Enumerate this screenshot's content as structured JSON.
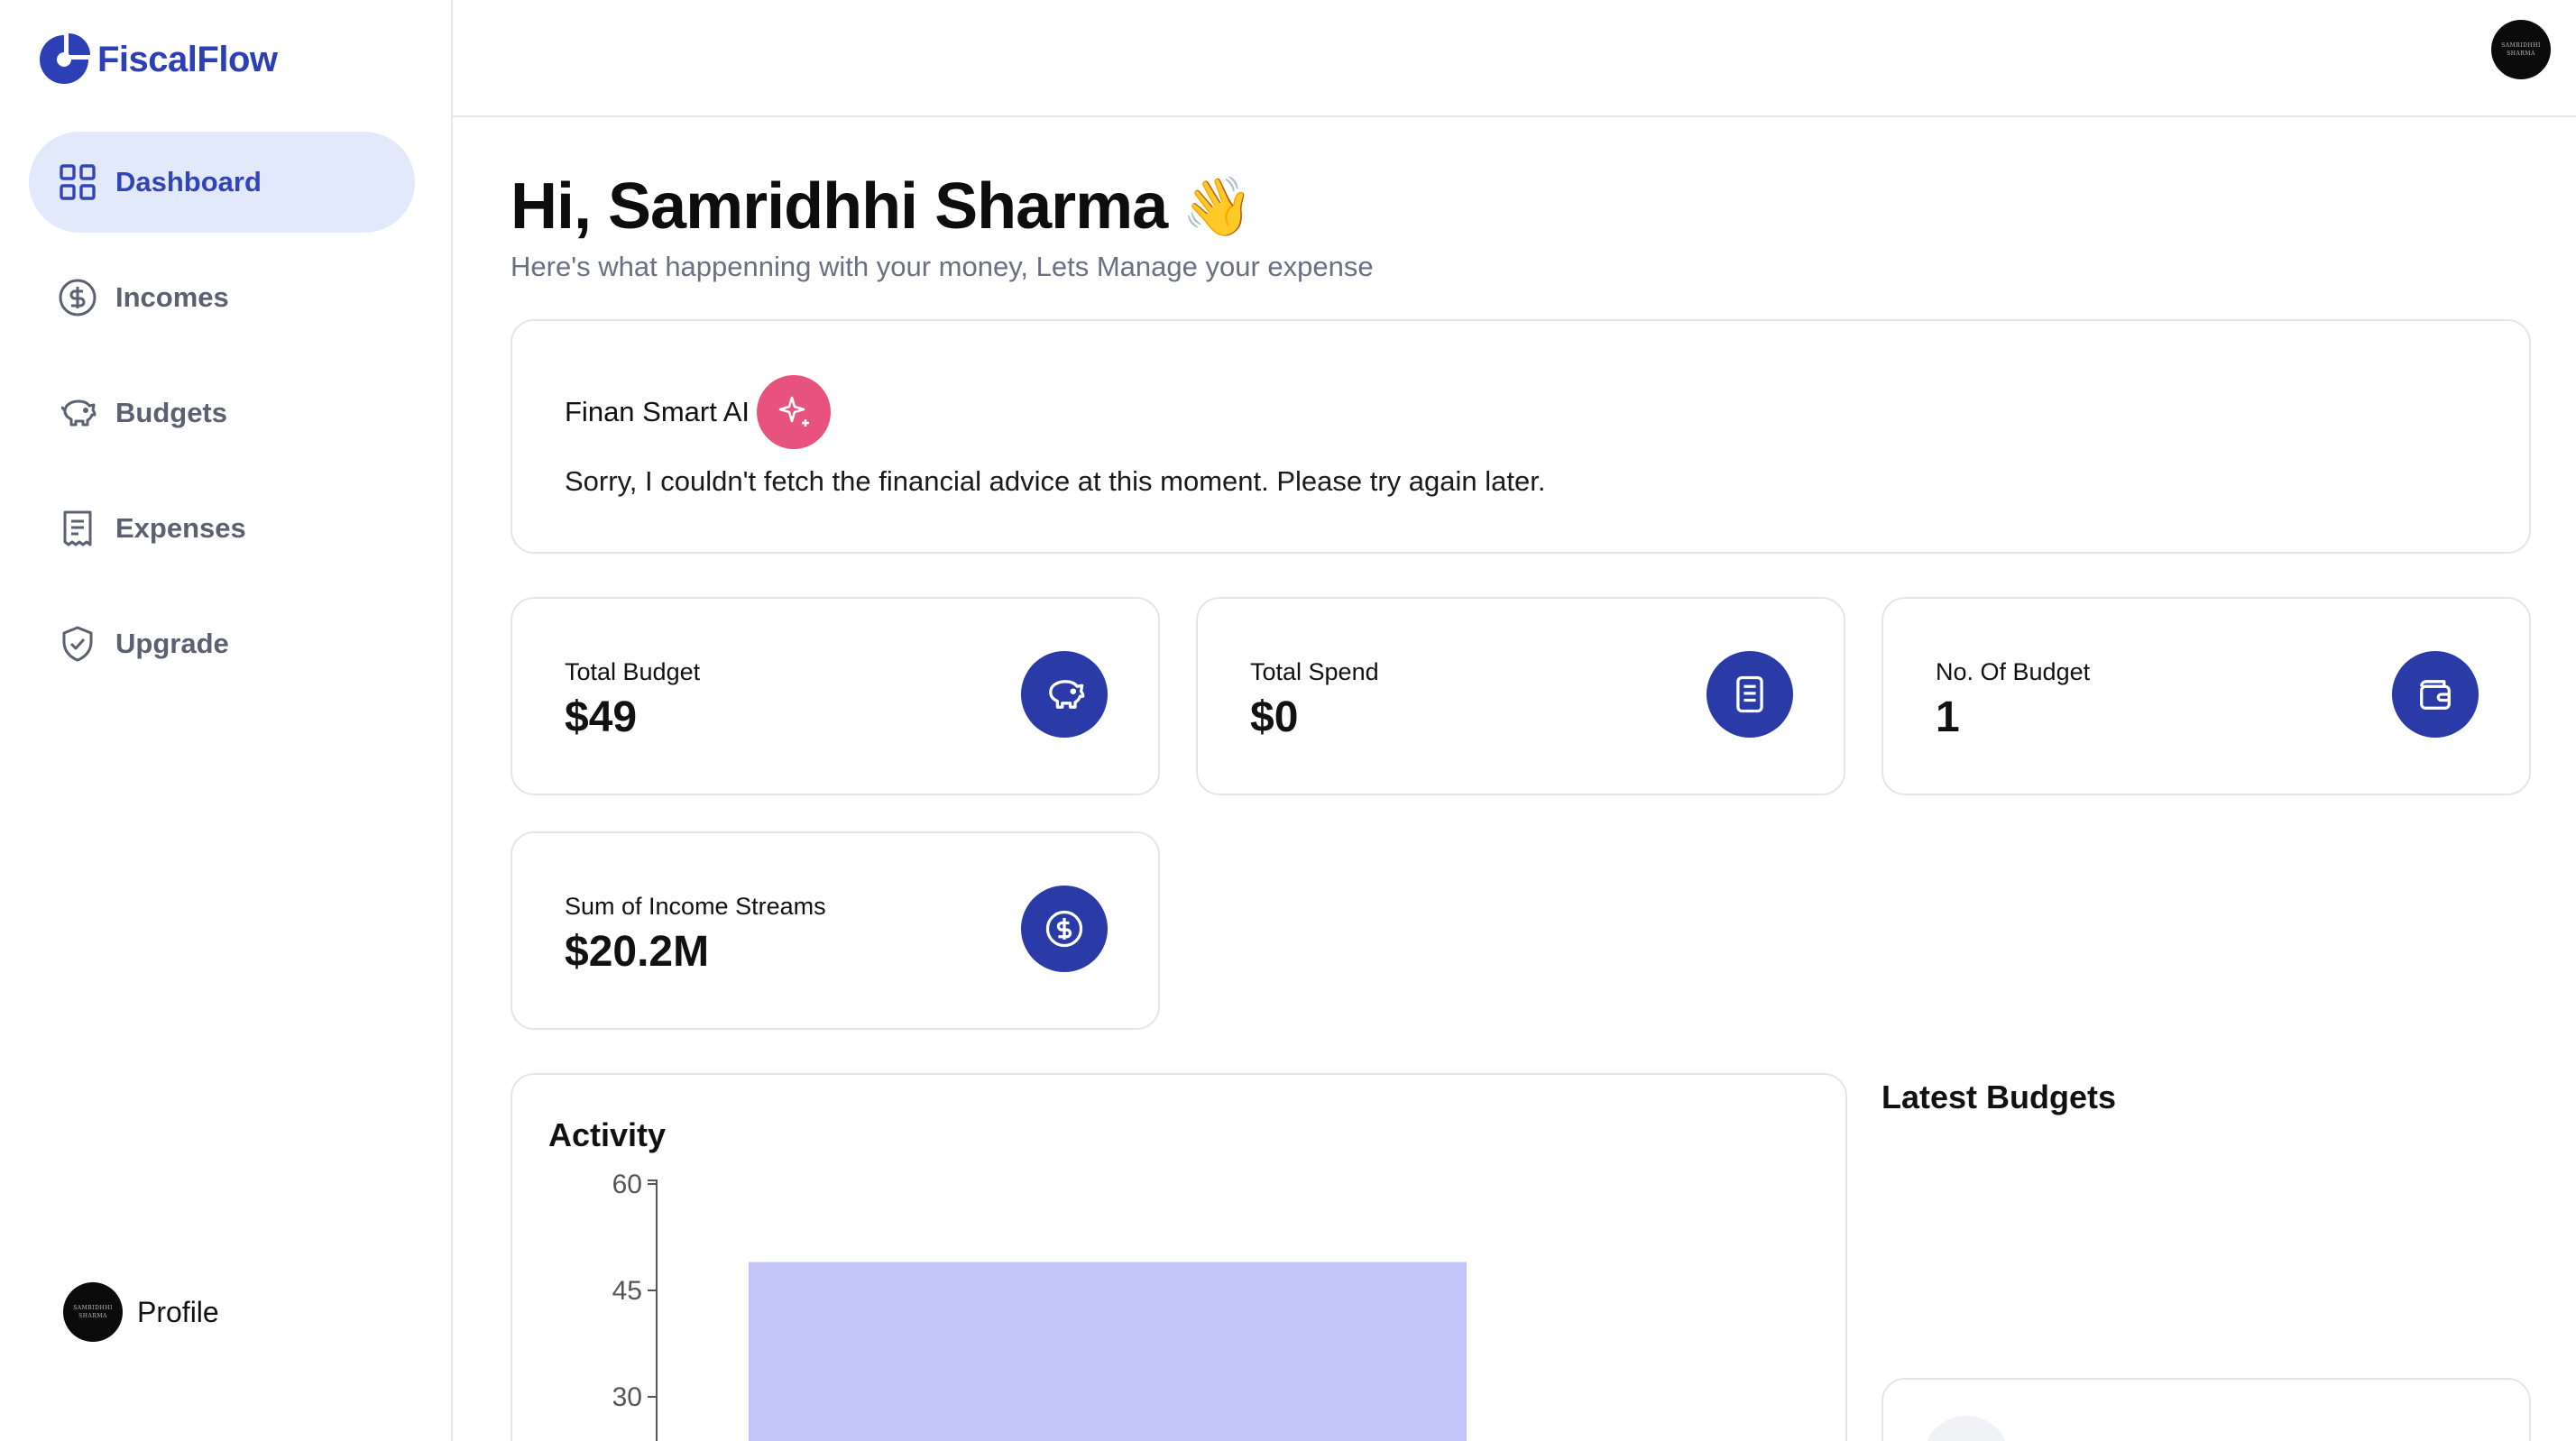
{
  "app": {
    "name": "FiscalFlow",
    "brand_color": "#2d3fb4"
  },
  "sidebar": {
    "items": [
      {
        "label": "Dashboard",
        "icon": "grid-icon",
        "active": true
      },
      {
        "label": "Incomes",
        "icon": "dollar-circle-icon",
        "active": false
      },
      {
        "label": "Budgets",
        "icon": "piggy-bank-icon",
        "active": false
      },
      {
        "label": "Expenses",
        "icon": "receipt-icon",
        "active": false
      },
      {
        "label": "Upgrade",
        "icon": "shield-check-icon",
        "active": false
      }
    ],
    "profile": {
      "label": "Profile",
      "avatar_text": "SAMRIDHHI SHARMA"
    }
  },
  "header": {
    "avatar_text": "SAMRIDHHI SHARMA"
  },
  "main": {
    "greeting": "Hi, Samridhhi Sharma",
    "greeting_emoji": "👋",
    "subtitle": "Here's what happenning with your money, Lets Manage your expense",
    "ai": {
      "title": "Finan Smart AI",
      "message": "Sorry, I couldn't fetch the financial advice at this moment. Please try again later.",
      "badge_color": "#e8527f"
    },
    "stats": [
      {
        "label": "Total Budget",
        "value": "$49",
        "icon": "piggy-bank-icon"
      },
      {
        "label": "Total Spend",
        "value": "$0",
        "icon": "receipt-icon"
      },
      {
        "label": "No. Of Budget",
        "value": "1",
        "icon": "wallet-icon"
      },
      {
        "label": "Sum of Income Streams",
        "value": "$20.2M",
        "icon": "dollar-circle-icon"
      }
    ],
    "activity": {
      "title": "Activity"
    },
    "latest_budgets": {
      "title": "Latest Budgets"
    }
  },
  "chart_data": {
    "type": "bar",
    "title": "Activity",
    "yticks": [
      60,
      45,
      30
    ],
    "ylim": [
      0,
      60
    ],
    "series": [
      {
        "values": [
          49
        ],
        "color": "#c3c4f8"
      }
    ],
    "grid": false
  }
}
